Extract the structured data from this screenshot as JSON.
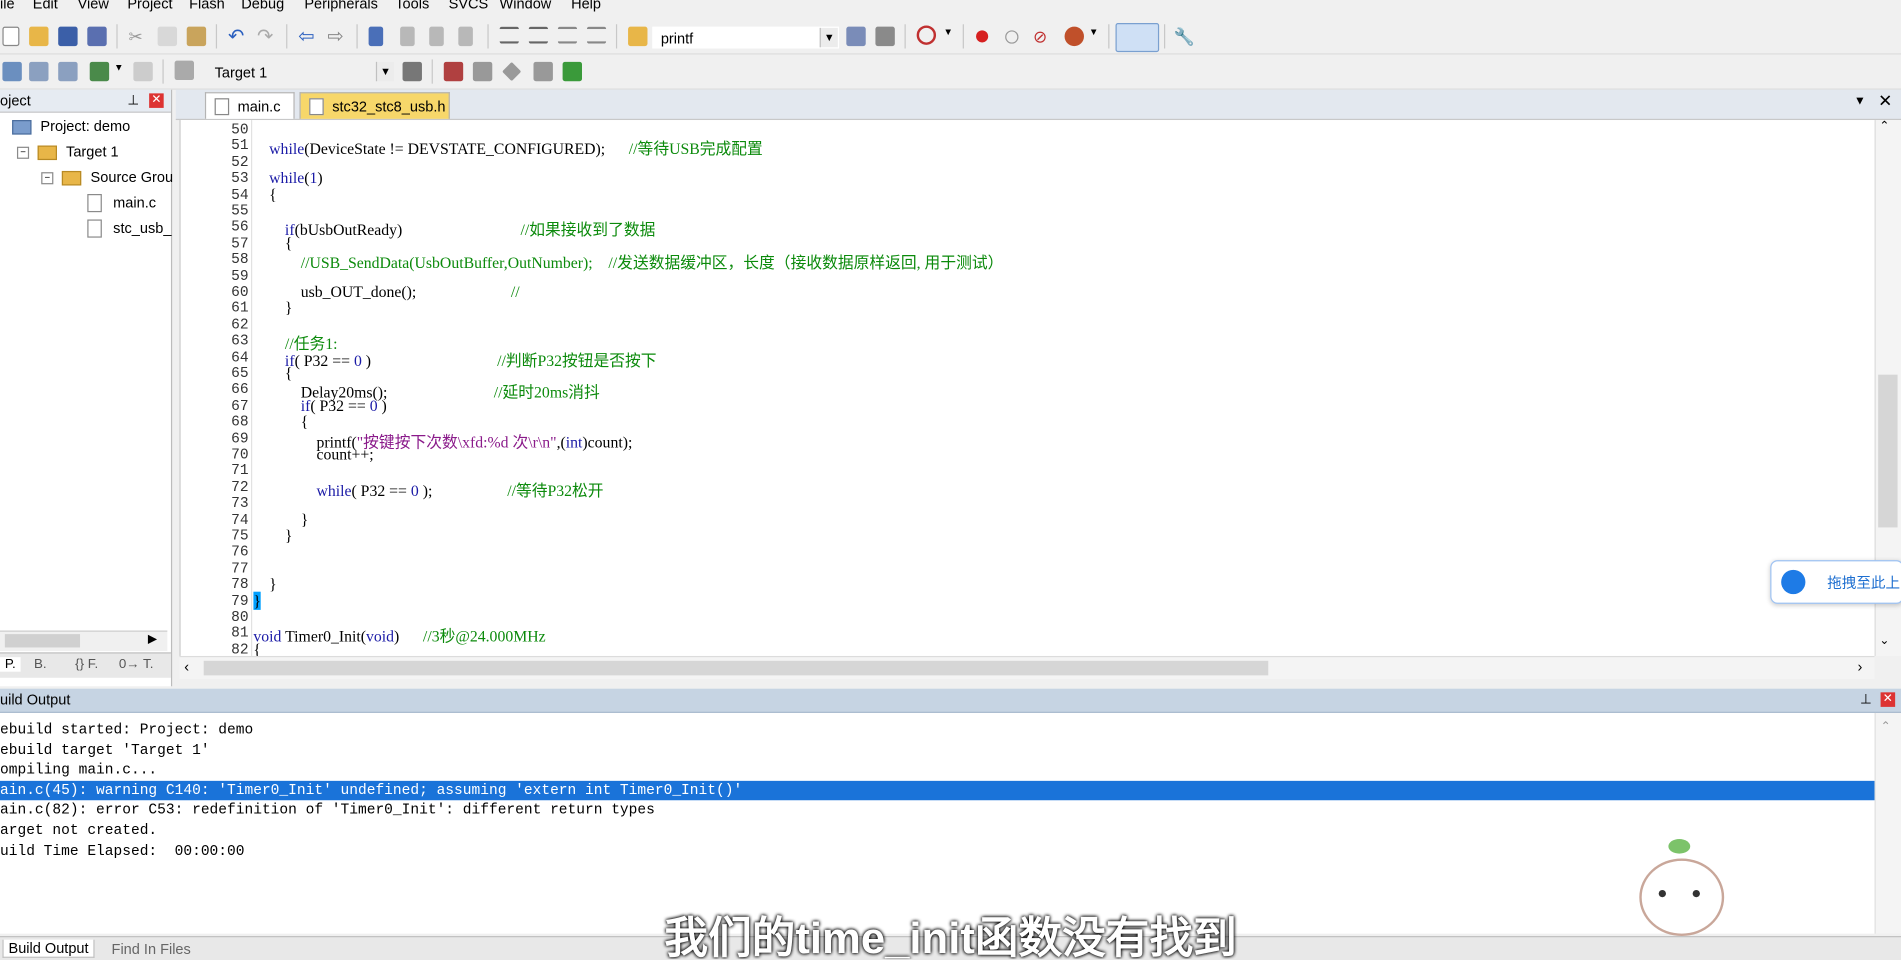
{
  "menu": [
    "ile",
    "Edit",
    "View",
    "Project",
    "Flash",
    "Debug",
    "Peripherals",
    "Tools",
    "SVCS",
    "Window",
    "Help"
  ],
  "toolbar": {
    "find_value": "printf",
    "target_value": "Target 1"
  },
  "project_panel": {
    "title": "oject",
    "root": "Project: demo",
    "target": "Target 1",
    "group": "Source Grou",
    "files": [
      "main.c",
      "stc_usb_"
    ],
    "bottom_tabs": [
      "P.",
      "B.",
      "{} F.",
      "0→ T."
    ]
  },
  "editor": {
    "tabs": [
      "main.c",
      "stc32_stc8_usb.h"
    ],
    "lines": [
      {
        "n": "50",
        "parts": []
      },
      {
        "n": "51",
        "parts": [
          [
            "kw",
            "    while"
          ],
          [
            "",
            "(DeviceState != DEVSTATE_CONFIGURED);      "
          ],
          [
            "cm",
            "//等待USB完成配置"
          ]
        ]
      },
      {
        "n": "52",
        "parts": []
      },
      {
        "n": "53",
        "parts": [
          [
            "kw",
            "    while"
          ],
          [
            "",
            "("
          ],
          [
            "num",
            "1"
          ],
          [
            "",
            ")"
          ]
        ]
      },
      {
        "n": "54",
        "parts": [
          [
            "",
            "    {"
          ]
        ]
      },
      {
        "n": "55",
        "parts": []
      },
      {
        "n": "56",
        "parts": [
          [
            "kw",
            "        if"
          ],
          [
            "",
            ""
          ],
          [
            "",
            "(bUsbOutReady)                              "
          ],
          [
            "cm",
            "//如果接收到了数据"
          ]
        ]
      },
      {
        "n": "57",
        "parts": [
          [
            "",
            "        {"
          ]
        ]
      },
      {
        "n": "58",
        "parts": [
          [
            "cm",
            "            //USB_SendData(UsbOutBuffer,OutNumber);    //发送数据缓冲区，长度（接收数据原样返回, 用于测试）"
          ]
        ]
      },
      {
        "n": "59",
        "parts": []
      },
      {
        "n": "60",
        "parts": [
          [
            "",
            "            usb_OUT_done();                        "
          ],
          [
            "cm",
            "//"
          ]
        ]
      },
      {
        "n": "61",
        "parts": [
          [
            "",
            "        }"
          ]
        ]
      },
      {
        "n": "62",
        "parts": []
      },
      {
        "n": "63",
        "parts": [
          [
            "cm",
            "        //任务1:"
          ]
        ]
      },
      {
        "n": "64",
        "parts": [
          [
            "kw",
            "        if"
          ],
          [
            "",
            "( P32 == "
          ],
          [
            "num",
            "0"
          ],
          [
            "",
            " )                                "
          ],
          [
            "cm",
            "//判断P32按钮是否按下"
          ]
        ]
      },
      {
        "n": "65",
        "parts": [
          [
            "",
            "        {"
          ]
        ]
      },
      {
        "n": "66",
        "parts": [
          [
            "",
            "            Delay20ms();                           "
          ],
          [
            "cm",
            "//延时20ms消抖"
          ]
        ]
      },
      {
        "n": "67",
        "parts": [
          [
            "kw",
            "            if"
          ],
          [
            "",
            "( P32 == "
          ],
          [
            "num",
            "0"
          ],
          [
            "",
            " )"
          ]
        ]
      },
      {
        "n": "68",
        "parts": [
          [
            "",
            "            {"
          ]
        ]
      },
      {
        "n": "69",
        "parts": [
          [
            "",
            "                printf("
          ],
          [
            "st",
            "\"按键按下次数\\xfd:%d 次\\r\\n\""
          ],
          [
            "",
            ",("
          ],
          [
            "kw",
            "int"
          ],
          [
            "",
            ")count);"
          ]
        ]
      },
      {
        "n": "70",
        "parts": [
          [
            "",
            "                count++;"
          ]
        ]
      },
      {
        "n": "71",
        "parts": []
      },
      {
        "n": "72",
        "parts": [
          [
            "kw",
            "                while"
          ],
          [
            "",
            "( P32 == "
          ],
          [
            "num",
            "0"
          ],
          [
            "",
            " );                   "
          ],
          [
            "cm",
            "//等待P32松开"
          ]
        ]
      },
      {
        "n": "73",
        "parts": []
      },
      {
        "n": "74",
        "parts": [
          [
            "",
            "            }"
          ]
        ]
      },
      {
        "n": "75",
        "parts": [
          [
            "",
            "        }"
          ]
        ]
      },
      {
        "n": "76",
        "parts": []
      },
      {
        "n": "77",
        "parts": []
      },
      {
        "n": "78",
        "parts": [
          [
            "",
            "    }"
          ]
        ]
      },
      {
        "n": "79",
        "parts": [
          [
            "",
            "}"
          ]
        ]
      },
      {
        "n": "80",
        "parts": []
      },
      {
        "n": "81",
        "parts": [
          [
            "kw",
            "void"
          ],
          [
            "",
            " Timer0_Init("
          ],
          [
            "kw",
            "void"
          ],
          [
            "",
            ")      "
          ],
          [
            "cm",
            "//3秒@24.000MHz"
          ]
        ]
      },
      {
        "n": "82",
        "parts": [
          [
            "",
            "{"
          ]
        ]
      }
    ]
  },
  "build_output": {
    "title": "uild Output",
    "lines": [
      "ebuild started: Project: demo",
      "ebuild target 'Target 1'",
      "ompiling main.c...",
      "ain.c(45): warning C140: 'Timer0_Init' undefined; assuming 'extern int Timer0_Init()'",
      "ain.c(82): error C53: redefinition of 'Timer0_Init': different return types",
      "arget not created.",
      "uild Time Elapsed:  00:00:00"
    ],
    "tabs": [
      "Build Output",
      "Find In Files"
    ]
  },
  "overlay": {
    "upload_label": "拖拽至此上",
    "subtitle": "我们的time_init函数没有找到"
  },
  "colors": {
    "keyword": "#1a1aa6",
    "comment": "#0b8a0b",
    "string": "#8a1a8a",
    "selection": "#1a73d9"
  }
}
